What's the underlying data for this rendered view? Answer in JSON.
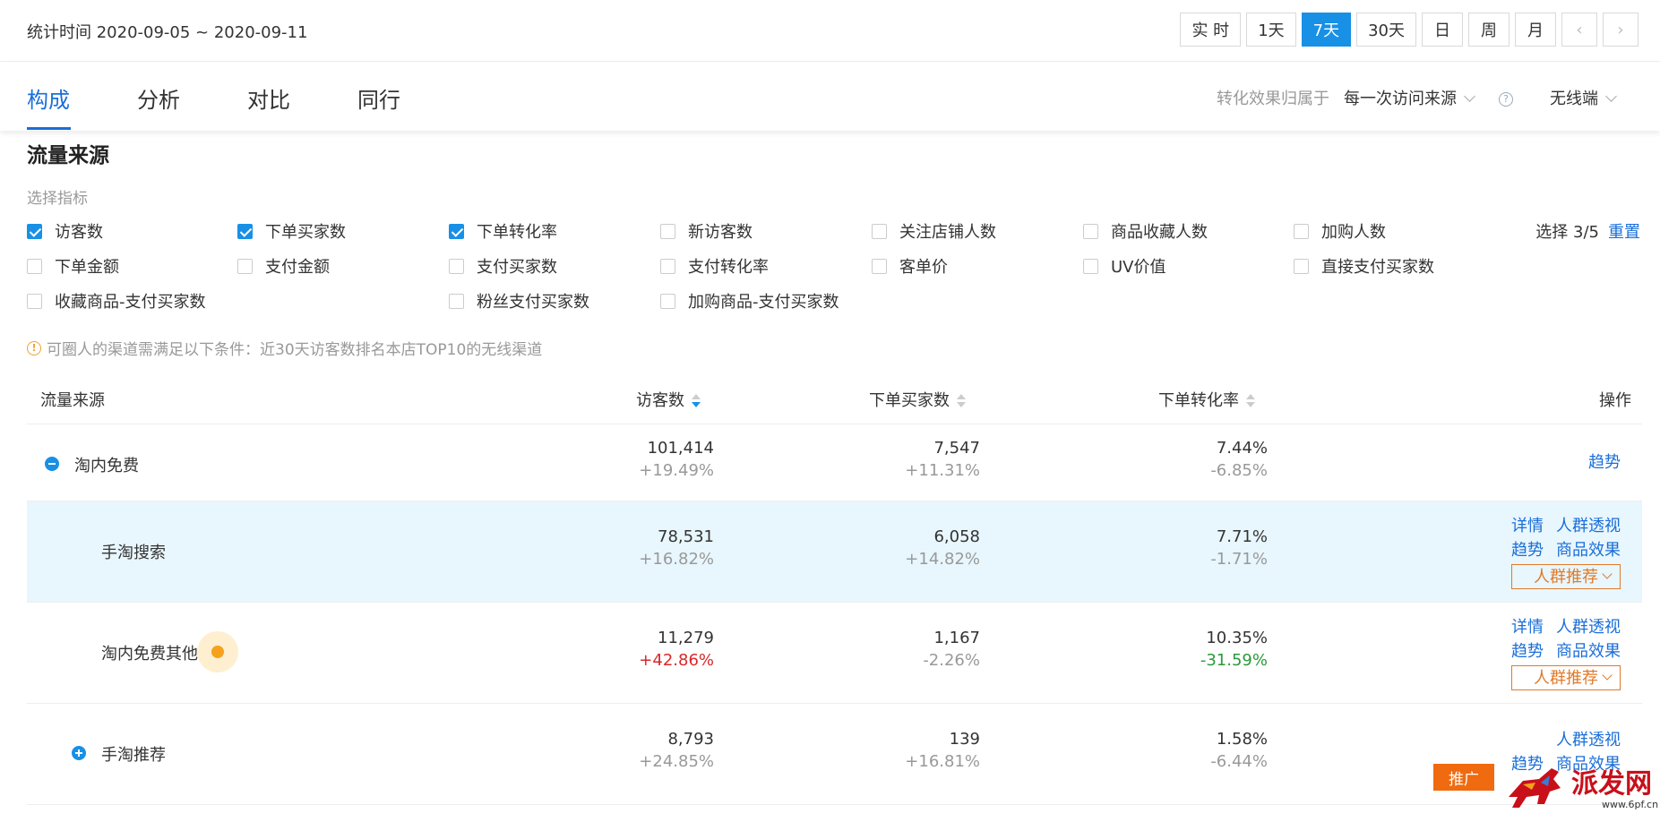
{
  "header": {
    "stat_time": "统计时间 2020-09-05 ~ 2020-09-11",
    "ranges": [
      "实 时",
      "1天",
      "7天",
      "30天",
      "日",
      "周",
      "月"
    ],
    "active_range": "7天"
  },
  "tabs": [
    "构成",
    "分析",
    "对比",
    "同行"
  ],
  "attribution": {
    "label": "转化效果归属于",
    "value": "每一次访问来源",
    "device": "无线端"
  },
  "section_title": "流量来源",
  "metric_picker": {
    "label": "选择指标",
    "selected_count": "选择 3/5",
    "reset": "重置",
    "metrics": [
      {
        "label": "访客数",
        "checked": true
      },
      {
        "label": "下单买家数",
        "checked": true
      },
      {
        "label": "下单转化率",
        "checked": true
      },
      {
        "label": "新访客数",
        "checked": false
      },
      {
        "label": "关注店铺人数",
        "checked": false
      },
      {
        "label": "商品收藏人数",
        "checked": false
      },
      {
        "label": "加购人数",
        "checked": false
      },
      {
        "label": "下单金额",
        "checked": false
      },
      {
        "label": "支付金额",
        "checked": false
      },
      {
        "label": "支付买家数",
        "checked": false
      },
      {
        "label": "支付转化率",
        "checked": false
      },
      {
        "label": "客单价",
        "checked": false
      },
      {
        "label": "UV价值",
        "checked": false
      },
      {
        "label": "直接支付买家数",
        "checked": false
      },
      {
        "label": "收藏商品-支付买家数",
        "checked": false
      },
      {
        "label": "粉丝支付买家数",
        "checked": false
      },
      {
        "label": "加购商品-支付买家数",
        "checked": false
      }
    ]
  },
  "notice": "可圈人的渠道需满足以下条件：近30天访客数排名本店TOP10的无线渠道",
  "table": {
    "headers": [
      "流量来源",
      "访客数",
      "下单买家数",
      "下单转化率",
      "操作"
    ],
    "rows": [
      {
        "name": "淘内免费",
        "visitors": "101,414",
        "visitors_change": "+19.49%",
        "buyers": "7,547",
        "buyers_change": "+11.31%",
        "rate": "7.44%",
        "rate_change": "-6.85%",
        "op_trend": "趋势"
      },
      {
        "name": "手淘搜索",
        "visitors": "78,531",
        "visitors_change": "+16.82%",
        "buyers": "6,058",
        "buyers_change": "+14.82%",
        "rate": "7.71%",
        "rate_change": "-1.71%",
        "op_detail": "详情",
        "op_crowd": "人群透视",
        "op_trend": "趋势",
        "op_product": "商品效果",
        "op_recommend": "人群推荐"
      },
      {
        "name": "淘内免费其他",
        "visitors": "11,279",
        "visitors_change": "+42.86%",
        "buyers": "1,167",
        "buyers_change": "-2.26%",
        "rate": "10.35%",
        "rate_change": "-31.59%",
        "op_detail": "详情",
        "op_crowd": "人群透视",
        "op_trend": "趋势",
        "op_product": "商品效果",
        "op_recommend": "人群推荐"
      },
      {
        "name": "手淘推荐",
        "visitors": "8,793",
        "visitors_change": "+24.85%",
        "buyers": "139",
        "buyers_change": "+16.81%",
        "rate": "1.58%",
        "rate_change": "-6.44%",
        "op_crowd": "人群透视",
        "op_trend": "趋势",
        "op_product": "商品效果"
      }
    ]
  },
  "promo": "推广",
  "watermark": {
    "text": "派发网",
    "url": "www.6pf.cn"
  }
}
